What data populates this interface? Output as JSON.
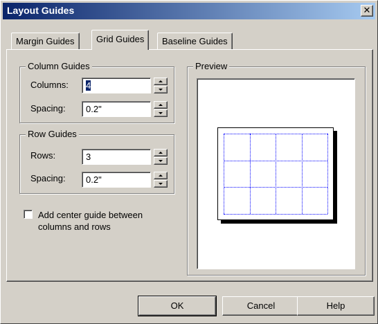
{
  "window": {
    "title": "Layout Guides",
    "close_label": "✕"
  },
  "tabs": [
    {
      "label": "Margin Guides",
      "active": false
    },
    {
      "label": "Grid Guides",
      "active": true
    },
    {
      "label": "Baseline Guides",
      "active": false
    }
  ],
  "column_guides": {
    "title": "Column Guides",
    "columns_label": "Columns:",
    "columns_value": "4",
    "spacing_label": "Spacing:",
    "spacing_value": "0.2\""
  },
  "row_guides": {
    "title": "Row Guides",
    "rows_label": "Rows:",
    "rows_value": "3",
    "spacing_label": "Spacing:",
    "spacing_value": "0.2\""
  },
  "center_guide": {
    "label_line1": "Add center guide between",
    "label_line2": "columns and rows",
    "checked": false
  },
  "preview": {
    "title": "Preview",
    "columns": 4,
    "rows": 3,
    "guide_color": "#0000ff"
  },
  "buttons": {
    "ok": "OK",
    "cancel": "Cancel",
    "help": "Help"
  },
  "colors": {
    "face": "#d4d0c8",
    "title_start": "#0a246a",
    "title_end": "#a6caf0"
  }
}
